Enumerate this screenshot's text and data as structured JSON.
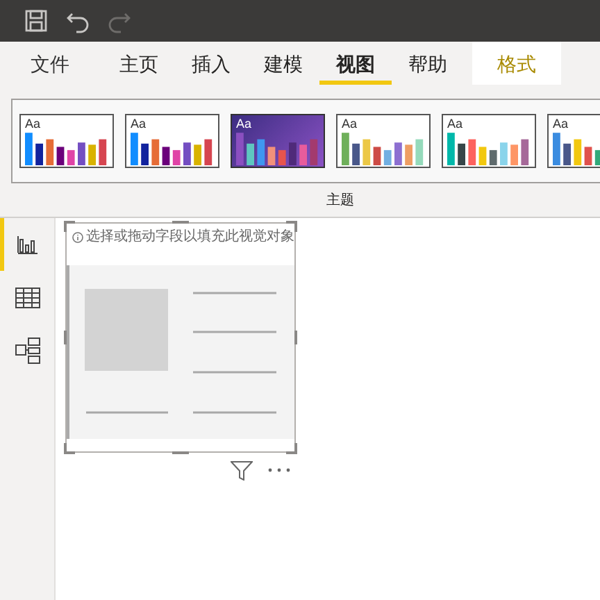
{
  "toolbar": [
    {
      "kind": "save",
      "disabled": false
    },
    {
      "kind": "undo",
      "disabled": false
    },
    {
      "kind": "redo",
      "disabled": true
    }
  ],
  "tabs": [
    {
      "label": "文件",
      "selected": false,
      "kind": "file"
    },
    {
      "label": "主页",
      "selected": false,
      "kind": "normal"
    },
    {
      "label": "插入",
      "selected": false,
      "kind": "normal"
    },
    {
      "label": "建模",
      "selected": false,
      "kind": "normal"
    },
    {
      "label": "视图",
      "selected": true,
      "kind": "normal"
    },
    {
      "label": "帮助",
      "selected": false,
      "kind": "normal"
    },
    {
      "label": "格式",
      "selected": false,
      "kind": "contextual"
    }
  ],
  "themes": {
    "label": "主题",
    "items": [
      {
        "label": "Aa",
        "selected": false
      },
      {
        "label": "Aa",
        "selected": false
      },
      {
        "label": "Aa",
        "selected": true
      },
      {
        "label": "Aa",
        "selected": false
      },
      {
        "label": "Aa",
        "selected": false
      },
      {
        "label": "Aa",
        "selected": false
      }
    ]
  },
  "views": [
    {
      "kind": "report",
      "selected": true
    },
    {
      "kind": "data",
      "selected": false
    },
    {
      "kind": "model",
      "selected": false
    }
  ],
  "visual": {
    "hint": "选择或拖动字段以填充此视觉对象"
  }
}
